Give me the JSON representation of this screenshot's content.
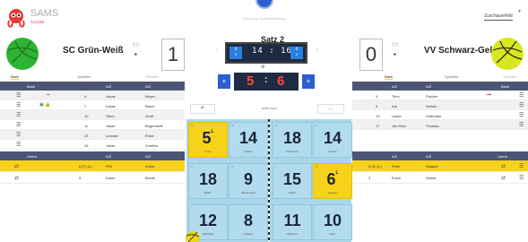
{
  "app": {
    "logo_title": "SAMS",
    "logo_subtitle": "SCORE"
  },
  "header": {
    "center_button": "Zurück zur Spielverwaltung",
    "right_link": "Zuschauerfeld"
  },
  "colors": {
    "header_row": "#4a5673",
    "highlight": "#f7d21a",
    "score": "#ff4a3a",
    "clock_bg": "#1f2b40",
    "blue": "#2b7fe0"
  },
  "left_team": {
    "name": "SC Grün-Weiß",
    "sets": "1",
    "tabs": [
      "Bank",
      "Spielfeld",
      "Offizielle"
    ],
    "table_headers": [
      "Bank",
      "",
      "Nr",
      "Name"
    ],
    "players": [
      {
        "nr": "4",
        "first": "Jonas",
        "last": "Meyer",
        "badges": ""
      },
      {
        "nr": "7",
        "first": "Lukas",
        "last": "Baum",
        "badges": ""
      },
      {
        "nr": "10",
        "first": "Olum",
        "last": "Groß",
        "badges": ""
      },
      {
        "nr": "11",
        "first": "Julian",
        "last": "Bogendorff",
        "badges": ""
      },
      {
        "nr": "13",
        "first": "Lennart",
        "last": "Ernst",
        "badges": ""
      },
      {
        "nr": "16",
        "first": "Julian",
        "last": "Zornfink",
        "badges": ""
      }
    ],
    "libero_header": "Libero",
    "liberos": [
      {
        "nr": "8 (T) (L)",
        "first": "Phil",
        "last": "Kunte"
      },
      {
        "nr": "9",
        "first": "Karim",
        "last": "Benali"
      }
    ]
  },
  "right_team": {
    "name": "VV Schwarz-Gelb",
    "sets": "0",
    "tabs": [
      "Bank",
      "Spielfeld",
      "Offizielle"
    ],
    "table_headers": [
      "Nr",
      "Name",
      "",
      "Bank"
    ],
    "players": [
      {
        "nr": "4",
        "first": "Timo",
        "last": "Fischer"
      },
      {
        "nr": "5",
        "first": "Kai",
        "last": "Schulz"
      },
      {
        "nr": "13",
        "first": "Lasse",
        "last": "Hoffmann"
      },
      {
        "nr": "17",
        "first": "Jan Paul",
        "last": "Thomas"
      }
    ],
    "libero_header": "Libero",
    "liberos": [
      {
        "nr": "8 (K) (L)",
        "first": "Peter",
        "last": "Wagner"
      },
      {
        "nr": "3",
        "first": "Erwin",
        "last": "Weber"
      }
    ]
  },
  "center": {
    "set_label": "Satz 2",
    "clock": "14 : 16",
    "timeout_left": "0",
    "timeout_right": "0",
    "score_left": "5",
    "score_right": "6",
    "score_sep": ":",
    "undo": "↶",
    "ctrl_text": "ROW: Punkt",
    "ctrl_disabled": "Fix"
  },
  "court": {
    "tiles": [
      {
        "n": "5",
        "label": "Kunte",
        "yellow": true,
        "sub": "L",
        "pos": "IV"
      },
      {
        "n": "14",
        "label": "Robert",
        "yellow": false,
        "sub": "",
        "pos": "III"
      },
      {
        "n": "18",
        "label": "Winterrock",
        "yellow": false,
        "sub": "",
        "pos": "II"
      },
      {
        "n": "14",
        "label": "Franke",
        "yellow": false,
        "sub": "",
        "pos": "II"
      },
      {
        "n": "18",
        "label": "Raber",
        "yellow": false,
        "sub": "",
        "pos": "V"
      },
      {
        "n": "9",
        "label": "Weidemann",
        "yellow": false,
        "sub": "",
        "pos": "VI"
      },
      {
        "n": "15",
        "label": "Dörfer",
        "yellow": false,
        "sub": "",
        "pos": "I"
      },
      {
        "n": "6",
        "label": "Wagner",
        "yellow": true,
        "sub": "L",
        "pos": "III"
      },
      {
        "n": "12",
        "label": "Wolowski",
        "yellow": false,
        "sub": "",
        "pos": "I"
      },
      {
        "n": "8",
        "label": "Gallager",
        "yellow": false,
        "sub": "",
        "pos": ""
      },
      {
        "n": "11",
        "label": "Heilbrunn",
        "yellow": false,
        "sub": "",
        "pos": ""
      },
      {
        "n": "10",
        "label": "Klein",
        "yellow": false,
        "sub": "",
        "pos": ""
      }
    ]
  }
}
